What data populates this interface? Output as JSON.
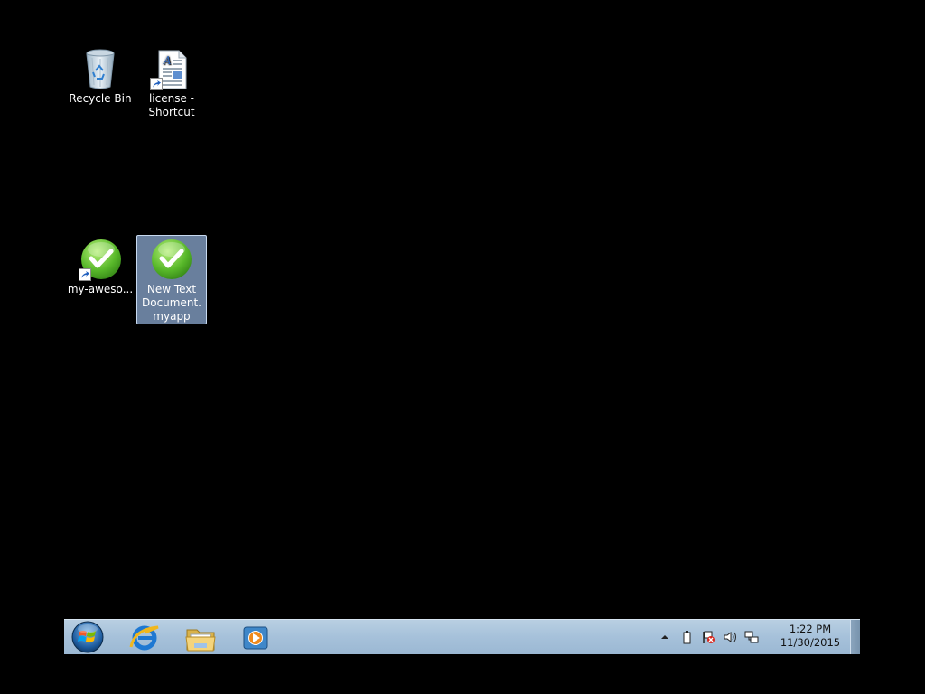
{
  "desktop": {
    "background_color": "#000000",
    "icons": [
      {
        "label": "Recycle Bin",
        "icon": "recycle-bin-icon",
        "shortcut": false,
        "selected": false
      },
      {
        "label": "license - Shortcut",
        "icon": "document-icon",
        "shortcut": true,
        "selected": false
      },
      {
        "label": "my-aweso...",
        "icon": "green-check-icon",
        "shortcut": true,
        "selected": false
      },
      {
        "label": "New Text Document.myapp",
        "icon": "green-check-icon",
        "shortcut": false,
        "selected": true
      }
    ]
  },
  "taskbar": {
    "color": "#a6c1da",
    "start_button": "windows-start-icon",
    "pinned": [
      {
        "name": "Internet Explorer",
        "icon": "internet-explorer-icon"
      },
      {
        "name": "Windows Explorer",
        "icon": "folder-icon"
      },
      {
        "name": "Windows Media Player",
        "icon": "media-player-icon"
      }
    ],
    "tray": {
      "icons": [
        "show-hidden-icons-icon",
        "battery-icon",
        "action-center-flag-icon",
        "volume-icon",
        "network-icon"
      ],
      "time": "1:22 PM",
      "date": "11/30/2015"
    }
  }
}
